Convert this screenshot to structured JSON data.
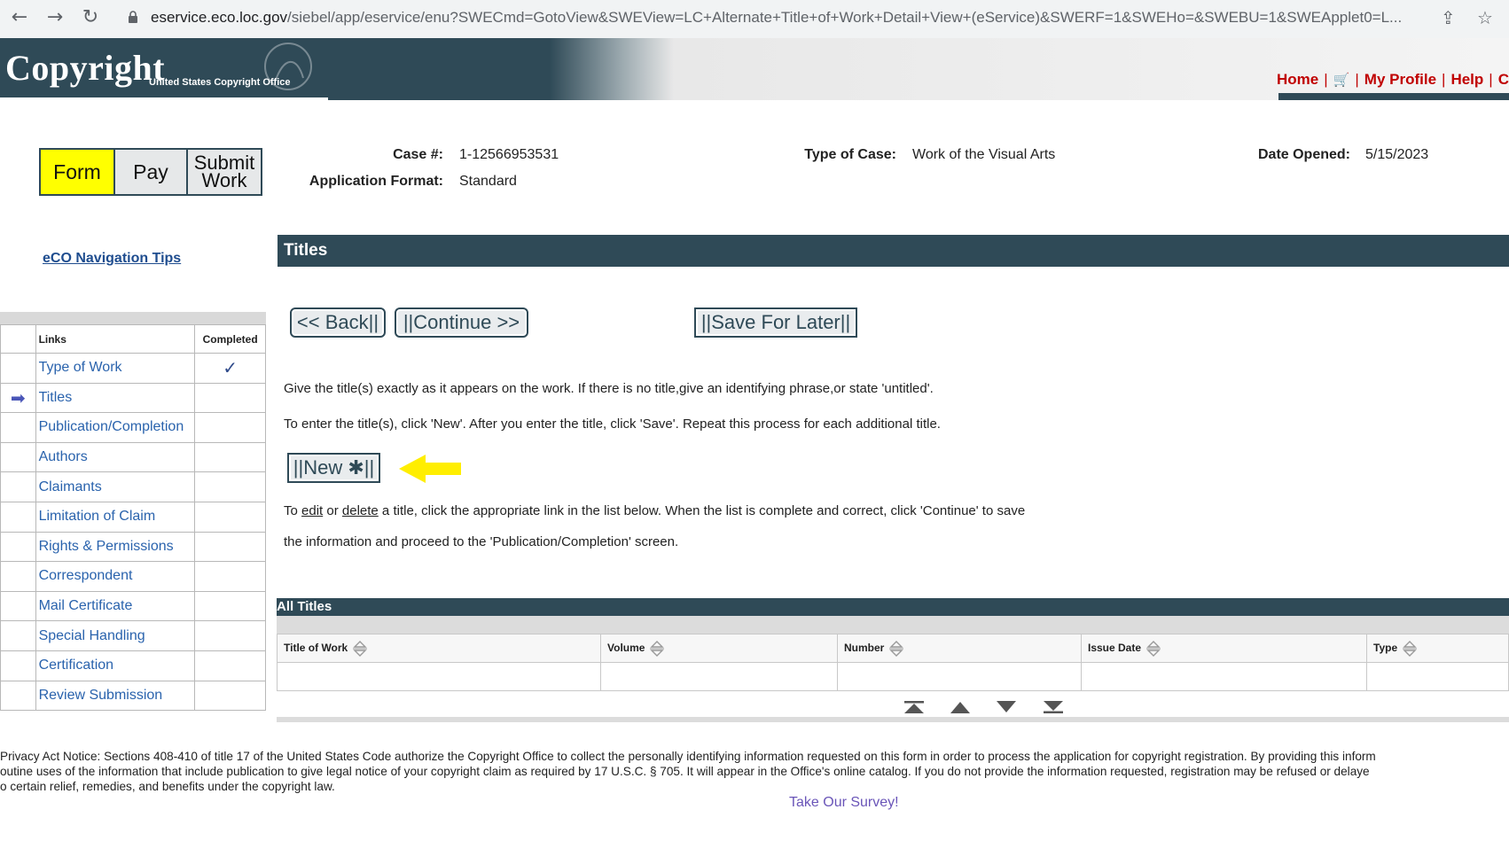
{
  "browser": {
    "url_host": "eservice.eco.loc.gov",
    "url_path": "/siebel/app/eservice/enu?SWECmd=GotoView&SWEView=LC+Alternate+Title+of+Work+Detail+View+(eService)&SWERF=1&SWEHo=&SWEBU=1&SWEApplet0=L..."
  },
  "header": {
    "logo_text": "Copyright",
    "logo_sub": "United States Copyright Office",
    "links": {
      "home": "Home",
      "my_profile": "My Profile",
      "help": "Help",
      "cut": "C"
    }
  },
  "steps": {
    "form": "Form",
    "pay": "Pay",
    "submit_line1": "Submit",
    "submit_line2": "Work"
  },
  "case": {
    "case_label": "Case #:",
    "case_value": "1-12566953531",
    "format_label": "Application Format:",
    "format_value": "Standard",
    "type_label": "Type of Case:",
    "type_value": "Work of the Visual Arts",
    "date_label": "Date Opened:",
    "date_value": "5/15/2023"
  },
  "sidebar": {
    "nav_tips": "eCO Navigation Tips",
    "col_links": "Links",
    "col_completed": "Completed",
    "items": [
      {
        "label": "Type of Work",
        "completed": "✓"
      },
      {
        "label": "Titles",
        "current": "➡"
      },
      {
        "label": "Publication/Completion"
      },
      {
        "label": "Authors"
      },
      {
        "label": "Claimants"
      },
      {
        "label": "Limitation of Claim"
      },
      {
        "label": "Rights & Permissions"
      },
      {
        "label": "Correspondent"
      },
      {
        "label": "Mail Certificate"
      },
      {
        "label": "Special Handling"
      },
      {
        "label": "Certification"
      },
      {
        "label": "Review Submission"
      }
    ]
  },
  "main": {
    "section_title": "Titles",
    "back": "<< Back||",
    "continue": "||Continue >>",
    "save_later": "||Save For Later||",
    "instruction1": "Give the title(s) exactly as it appears on the work. If there is no title,give an identifying phrase,or state 'untitled'.",
    "instruction2": "To enter the title(s), click 'New'. After you enter the title, click 'Save'. Repeat this process for each additional title.",
    "new_button": "||New ✱||",
    "instruction3_pre": "To ",
    "instruction3_edit": "edit",
    "instruction3_or": " or ",
    "instruction3_delete": "delete",
    "instruction3_post": " a title, click the appropriate link in the list below. When the list is complete and correct, click 'Continue' to save",
    "instruction4": "the information and proceed to the 'Publication/Completion' screen."
  },
  "all_titles": {
    "title": "All Titles",
    "columns": [
      "Title of Work",
      "Volume",
      "Number",
      "Issue Date",
      "Type"
    ]
  },
  "footer": {
    "privacy_line1": "Privacy Act Notice: Sections 408-410 of title 17 of the United States Code authorize the Copyright Office to collect the personally identifying information requested on this form in order to process the application for copyright registration. By providing this inform",
    "privacy_line2": "outine uses of the information that include publication to give legal notice of your copyright claim as required by 17 U.S.C. § 705. It will appear in the Office's online catalog. If you do not provide the information requested, registration may be refused or delaye",
    "privacy_line3": "o certain relief, remedies, and benefits under the copyright law.",
    "survey": "Take Our Survey!"
  },
  "colors": {
    "dark_header": "#2f4a57",
    "link_blue": "#2a63ad",
    "header_red": "#c00000",
    "active_step": "#ffff00"
  }
}
